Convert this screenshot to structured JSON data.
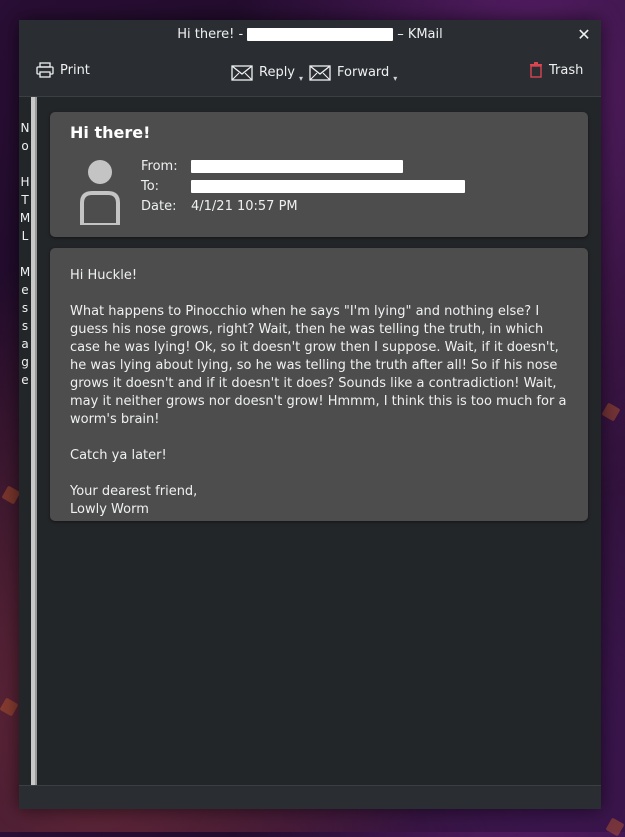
{
  "window": {
    "title_prefix": "Hi there! -",
    "title_suffix": "– KMail",
    "close_icon": "close-icon"
  },
  "toolbar": {
    "print_label": "Print",
    "reply_label": "Reply",
    "forward_label": "Forward",
    "trash_label": "Trash"
  },
  "html_indicator": {
    "letters": [
      "N",
      "o",
      "",
      "H",
      "T",
      "M",
      "L",
      "",
      "M",
      "e",
      "s",
      "s",
      "a",
      "g",
      "e"
    ]
  },
  "header": {
    "subject": "Hi there!",
    "from_label": "From:",
    "to_label": "To:",
    "date_label": "Date:",
    "date_value": "4/1/21 10:57 PM"
  },
  "body": {
    "text": "Hi Huckle!\n\nWhat happens to Pinocchio when he says \"I'm lying\" and nothing else? I guess his nose grows, right? Wait, then he was telling the truth, in which case he was lying! Ok, so it doesn't grow then I suppose. Wait, if it doesn't, he was lying about lying, so he was telling the truth after all! So if his nose grows it doesn't and if it doesn't it does? Sounds like a contradiction! Wait, may it neither grows nor doesn't grow! Hmmm, I think this is too much for a worm's brain!\n\nCatch ya later!\n\nYour dearest friend,\nLowly Worm"
  },
  "colors": {
    "window_bg": "#232629",
    "card_bg": "#4d4d4d",
    "trash_red": "#da4453",
    "text": "#eff0f1"
  }
}
